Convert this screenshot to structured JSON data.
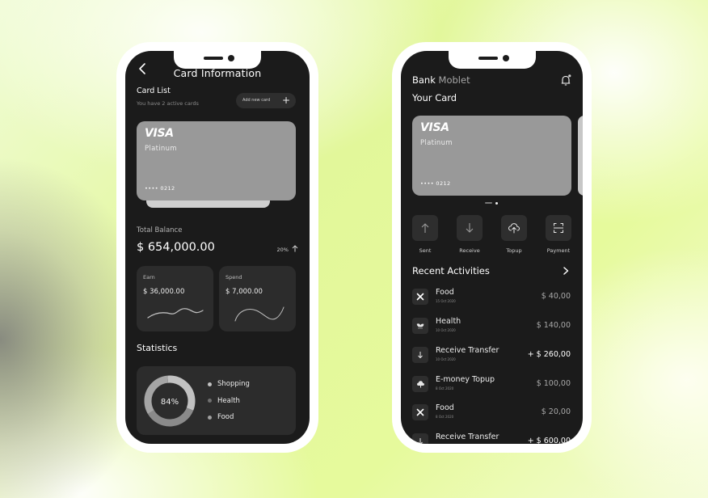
{
  "card_information_screen": {
    "title": "Card Information",
    "card_list": {
      "title": "Card List",
      "subtitle": "You have 2 active cards",
      "add_button_label": "Add new card",
      "add_button_icon": "plus-icon"
    },
    "card": {
      "brand": "VISA",
      "tier": "Platinum",
      "number_masked": "•••• 0212"
    },
    "total_balance": {
      "label": "Total Balance",
      "value": "$ 654,000.00",
      "change": "20%",
      "change_icon": "arrow-up-icon"
    },
    "earn": {
      "label": "Earn",
      "value": "$ 36,000.00"
    },
    "spend": {
      "label": "Spend",
      "value": "$ 7,000.00"
    },
    "statistics": {
      "title": "Statistics",
      "center_label": "84%",
      "segments": [
        {
          "name": "Shopping",
          "color": "#c2c2c2"
        },
        {
          "name": "Health",
          "color": "#707070"
        },
        {
          "name": "Food",
          "color": "#a0a0a0"
        }
      ]
    }
  },
  "home_screen": {
    "brand_primary": "Bank",
    "brand_secondary": "Moblet",
    "notification_icon": "bell-icon",
    "section_title": "Your Card",
    "card": {
      "brand": "VISA",
      "tier": "Platinum",
      "number_masked": "•••• 0212"
    },
    "card_pager": {
      "count": 2,
      "active_index": 0
    },
    "actions": [
      {
        "label": "Sent",
        "icon": "arrow-up-icon"
      },
      {
        "label": "Receive",
        "icon": "arrow-down-icon"
      },
      {
        "label": "Topup",
        "icon": "cloud-upload-icon"
      },
      {
        "label": "Payment",
        "icon": "scan-icon"
      }
    ],
    "recent_activities": {
      "title": "Recent Activities",
      "items": [
        {
          "name": "Food",
          "date": "15 Oct 2020",
          "amount": "$ 40,00",
          "icon": "fork-knife-icon",
          "positive": false
        },
        {
          "name": "Health",
          "date": "10 Oct 2020",
          "amount": "$ 140,00",
          "icon": "leaf-icon",
          "positive": false
        },
        {
          "name": "Receive Transfer",
          "date": "10 Oct 2020",
          "amount": "+ $ 260,00",
          "icon": "arrow-down-icon",
          "positive": true
        },
        {
          "name": "E-money Topup",
          "date": "8 Oct 2020",
          "amount": "$ 100,00",
          "icon": "cloud-upload-icon",
          "positive": false
        },
        {
          "name": "Food",
          "date": "8 Oct 2020",
          "amount": "$ 20,00",
          "icon": "fork-knife-icon",
          "positive": false
        },
        {
          "name": "Receive Transfer",
          "date": "",
          "amount": "+ $ 600,00",
          "icon": "arrow-down-icon",
          "positive": true
        }
      ]
    }
  }
}
